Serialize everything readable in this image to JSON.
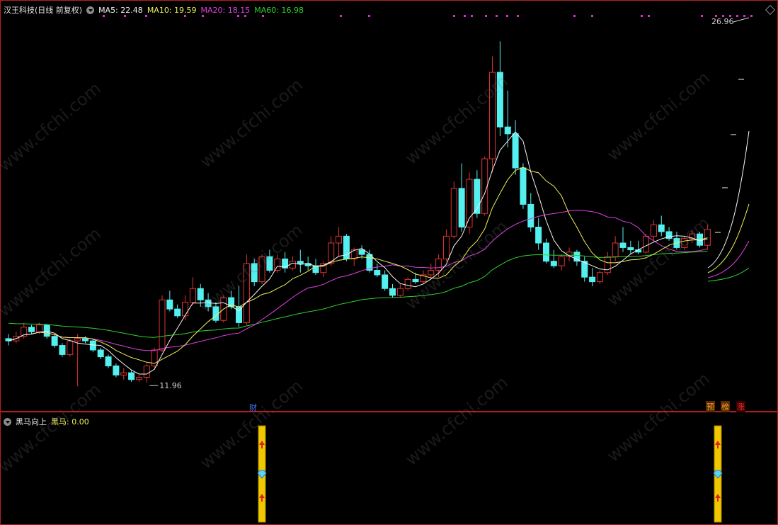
{
  "header": {
    "stock_name": "汉王科技(日线 前复权)",
    "ma5": "MA5: 22.48",
    "ma10": "MA10: 19.59",
    "ma20": "MA20: 18.15",
    "ma60": "MA60: 16.98"
  },
  "annotations": {
    "high_label": "26.96",
    "low_label": "11.96",
    "cai_marker": "财",
    "tag_yu": "预",
    "tag_bang": "榜",
    "tag_zhang": "涨"
  },
  "indicator": {
    "name": "黑马向上",
    "value_label": "黑马: 0.00"
  },
  "watermark": "www.cfchi.com",
  "colors": {
    "up": "#e03232",
    "down": "#54f0f0",
    "ma5": "#f4f4f4",
    "ma10": "#f0f05a",
    "ma20": "#e040e0",
    "ma60": "#30d030",
    "border": "#b41e1e"
  },
  "chart_data": {
    "type": "candlestick",
    "price_range": [
      11.5,
      28.0
    ],
    "high": 26.96,
    "low": 11.96,
    "candles": [
      [
        13.9,
        14.1,
        13.6,
        13.8
      ],
      [
        13.8,
        14.2,
        13.7,
        14.0
      ],
      [
        14.0,
        14.6,
        13.9,
        14.4
      ],
      [
        14.4,
        14.5,
        14.1,
        14.2
      ],
      [
        14.2,
        14.6,
        14.1,
        14.5
      ],
      [
        14.5,
        14.5,
        13.9,
        14.0
      ],
      [
        14.0,
        14.1,
        13.5,
        13.6
      ],
      [
        13.6,
        13.7,
        13.1,
        13.2
      ],
      [
        13.2,
        13.9,
        13.1,
        13.8
      ],
      [
        13.8,
        14.1,
        11.8,
        13.9
      ],
      [
        13.9,
        14.0,
        13.7,
        13.8
      ],
      [
        13.8,
        13.9,
        13.3,
        13.4
      ],
      [
        13.4,
        13.5,
        13.0,
        13.1
      ],
      [
        13.1,
        13.2,
        12.6,
        12.7
      ],
      [
        12.7,
        12.8,
        12.2,
        12.3
      ],
      [
        12.3,
        12.6,
        12.1,
        12.4
      ],
      [
        12.4,
        12.5,
        12.0,
        12.1
      ],
      [
        12.1,
        12.3,
        12.0,
        12.2
      ],
      [
        12.2,
        12.8,
        11.96,
        12.7
      ],
      [
        12.7,
        13.5,
        12.6,
        13.4
      ],
      [
        13.4,
        15.8,
        13.3,
        15.6
      ],
      [
        15.6,
        16.0,
        15.1,
        15.2
      ],
      [
        15.2,
        15.4,
        14.8,
        14.9
      ],
      [
        14.9,
        15.8,
        14.7,
        15.5
      ],
      [
        15.5,
        16.6,
        15.4,
        16.1
      ],
      [
        16.1,
        16.3,
        15.3,
        15.6
      ],
      [
        15.6,
        15.9,
        15.1,
        15.3
      ],
      [
        15.3,
        15.5,
        14.6,
        14.7
      ],
      [
        14.7,
        15.8,
        14.6,
        15.7
      ],
      [
        15.7,
        16.0,
        15.2,
        15.3
      ],
      [
        15.3,
        16.2,
        14.4,
        14.6
      ],
      [
        14.6,
        17.6,
        14.5,
        17.2
      ],
      [
        17.2,
        17.4,
        16.2,
        16.4
      ],
      [
        16.4,
        17.6,
        16.3,
        17.5
      ],
      [
        17.5,
        17.8,
        16.8,
        16.9
      ],
      [
        16.9,
        17.6,
        16.8,
        17.4
      ],
      [
        17.4,
        17.7,
        16.8,
        17.0
      ],
      [
        17.0,
        17.5,
        16.9,
        17.3
      ],
      [
        17.3,
        17.8,
        16.8,
        17.2
      ],
      [
        17.2,
        17.5,
        16.9,
        17.1
      ],
      [
        17.1,
        17.4,
        16.7,
        16.8
      ],
      [
        16.8,
        17.3,
        16.6,
        17.2
      ],
      [
        17.2,
        18.4,
        17.1,
        18.1
      ],
      [
        18.1,
        18.8,
        17.5,
        18.4
      ],
      [
        18.4,
        18.5,
        17.3,
        17.4
      ],
      [
        17.4,
        17.9,
        17.1,
        17.8
      ],
      [
        17.8,
        18.0,
        17.4,
        17.6
      ],
      [
        17.6,
        17.8,
        16.8,
        16.9
      ],
      [
        16.9,
        17.2,
        16.6,
        16.7
      ],
      [
        16.7,
        16.9,
        16.0,
        16.1
      ],
      [
        16.1,
        16.3,
        15.7,
        15.8
      ],
      [
        15.8,
        16.3,
        15.7,
        16.1
      ],
      [
        16.1,
        16.6,
        16.0,
        16.5
      ],
      [
        16.5,
        16.8,
        16.3,
        16.4
      ],
      [
        16.4,
        16.9,
        16.3,
        16.7
      ],
      [
        16.7,
        17.2,
        16.6,
        16.9
      ],
      [
        16.9,
        17.6,
        16.6,
        17.4
      ],
      [
        17.4,
        18.7,
        17.3,
        18.4
      ],
      [
        18.4,
        20.8,
        18.3,
        20.5
      ],
      [
        20.5,
        21.6,
        18.6,
        18.8
      ],
      [
        18.8,
        21.2,
        18.5,
        20.9
      ],
      [
        20.9,
        21.3,
        19.2,
        19.4
      ],
      [
        19.4,
        21.9,
        19.3,
        21.8
      ],
      [
        21.8,
        26.3,
        21.2,
        25.6
      ],
      [
        25.6,
        26.96,
        22.8,
        23.2
      ],
      [
        23.2,
        24.8,
        22.3,
        22.9
      ],
      [
        22.9,
        23.5,
        21.1,
        21.4
      ],
      [
        21.4,
        21.6,
        19.6,
        19.8
      ],
      [
        19.8,
        20.3,
        18.6,
        18.8
      ],
      [
        18.8,
        19.2,
        17.8,
        18.1
      ],
      [
        18.1,
        18.3,
        17.2,
        17.3
      ],
      [
        17.3,
        17.8,
        17.0,
        17.1
      ],
      [
        17.1,
        17.6,
        16.9,
        17.5
      ],
      [
        17.5,
        17.9,
        17.3,
        17.7
      ],
      [
        17.7,
        17.8,
        17.1,
        17.3
      ],
      [
        17.3,
        17.5,
        16.4,
        16.6
      ],
      [
        16.6,
        17.0,
        16.2,
        16.4
      ],
      [
        16.4,
        16.9,
        16.3,
        16.8
      ],
      [
        16.8,
        17.7,
        16.7,
        17.5
      ],
      [
        17.5,
        18.4,
        17.3,
        18.1
      ],
      [
        18.1,
        18.8,
        17.7,
        17.9
      ],
      [
        17.9,
        18.2,
        17.6,
        17.8
      ],
      [
        17.8,
        18.2,
        17.6,
        17.7
      ],
      [
        17.7,
        18.5,
        17.6,
        18.4
      ],
      [
        18.4,
        19.1,
        18.2,
        18.9
      ],
      [
        18.9,
        19.3,
        18.4,
        18.6
      ],
      [
        18.6,
        18.8,
        18.2,
        18.3
      ],
      [
        18.3,
        18.6,
        17.8,
        17.9
      ],
      [
        17.9,
        18.4,
        17.8,
        18.3
      ],
      [
        18.3,
        18.7,
        18.1,
        18.5
      ],
      [
        18.5,
        18.6,
        17.9,
        18.0
      ],
      [
        18.0,
        18.9,
        17.8,
        18.7
      ]
    ],
    "ma_end_values": {
      "MA5": 22.48,
      "MA10": 19.59,
      "MA20": 18.15,
      "MA60": 16.98
    },
    "signal_bars": [
      33,
      95
    ]
  }
}
